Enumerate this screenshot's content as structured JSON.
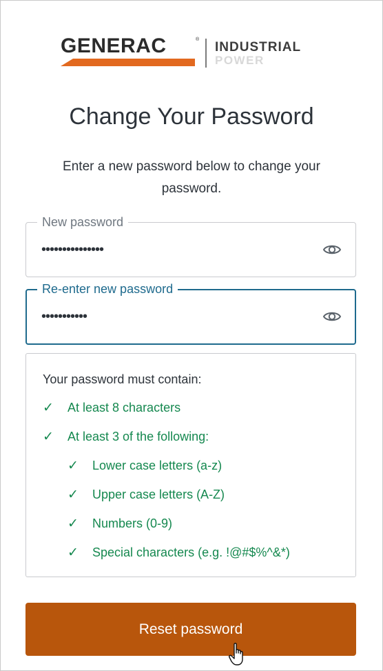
{
  "brand": {
    "name": "GENERAC",
    "registered_mark": "®",
    "line1": "INDUSTRIAL",
    "line2": "POWER",
    "accent_color": "#e2691f"
  },
  "page": {
    "title": "Change Your Password",
    "description": "Enter a new password below to change your password."
  },
  "form": {
    "new_password": {
      "label": "New password",
      "value": "•••••••••••••••",
      "reveal_icon": "eye-icon"
    },
    "confirm_password": {
      "label": "Re-enter new password",
      "value": "•••••••••••",
      "reveal_icon": "eye-icon",
      "focused": true
    }
  },
  "requirements": {
    "heading": "Your password must contain:",
    "check_symbol": "✓",
    "items": [
      {
        "text": "At least 8 characters",
        "met": true,
        "level": 0
      },
      {
        "text": "At least 3 of the following:",
        "met": true,
        "level": 0
      },
      {
        "text": "Lower case letters (a-z)",
        "met": true,
        "level": 1
      },
      {
        "text": "Upper case letters (A-Z)",
        "met": true,
        "level": 1
      },
      {
        "text": "Numbers (0-9)",
        "met": true,
        "level": 1
      },
      {
        "text": "Special characters (e.g. !@#$%^&*)",
        "met": true,
        "level": 1
      }
    ]
  },
  "actions": {
    "submit_label": "Reset password"
  },
  "colors": {
    "primary_button": "#b8560c",
    "focus_border": "#1e6a8d",
    "success": "#15884f",
    "text": "#2d333a"
  }
}
